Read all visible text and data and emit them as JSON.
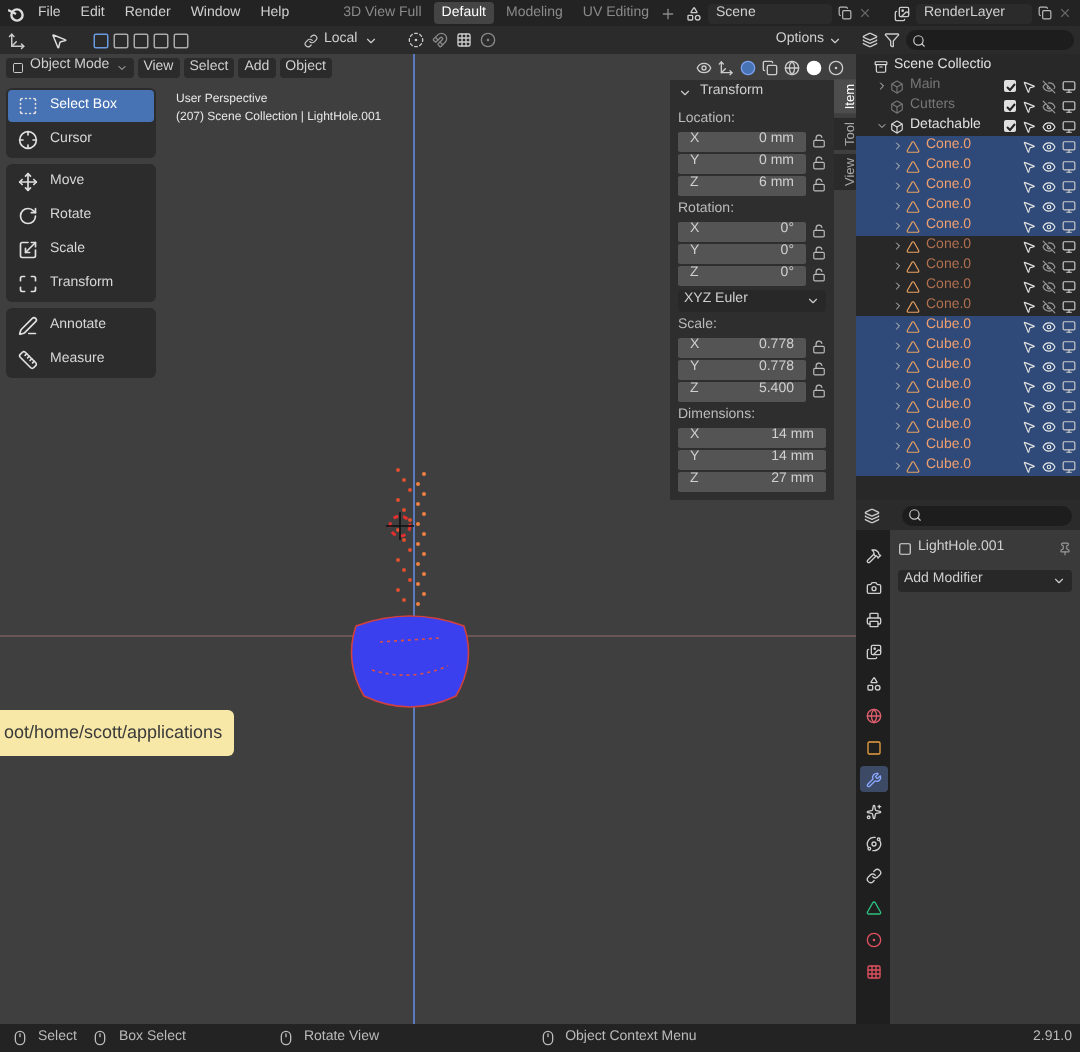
{
  "menu": [
    "File",
    "Edit",
    "Render",
    "Window",
    "Help"
  ],
  "workspace_tabs": [
    {
      "label": "3D View Full",
      "selected": false
    },
    {
      "label": "Default",
      "selected": true
    },
    {
      "label": "Modeling",
      "selected": false
    },
    {
      "label": "UV Editing",
      "selected": false
    }
  ],
  "scene": "Scene",
  "view_layer": "RenderLayer",
  "tool_settings": {
    "orientation": "Local",
    "options": "Options"
  },
  "viewport_header": {
    "mode": "Object Mode",
    "menus": [
      "View",
      "Select",
      "Add",
      "Object"
    ]
  },
  "toolbar": [
    {
      "tools": [
        {
          "kind": "select_box",
          "label": "Select Box",
          "selected": true
        },
        {
          "kind": "cursor",
          "label": "Cursor",
          "selected": false
        }
      ]
    },
    {
      "tools": [
        {
          "kind": "move",
          "label": "Move",
          "selected": false
        },
        {
          "kind": "rotate",
          "label": "Rotate",
          "selected": false
        },
        {
          "kind": "scale",
          "label": "Scale",
          "selected": false
        },
        {
          "kind": "transform",
          "label": "Transform",
          "selected": false
        }
      ]
    },
    {
      "tools": [
        {
          "kind": "annotate",
          "label": "Annotate",
          "selected": false
        },
        {
          "kind": "measure",
          "label": "Measure",
          "selected": false
        }
      ]
    }
  ],
  "overlay_text": [
    "User Perspective",
    "(207) Scene Collection | LightHole.001"
  ],
  "sidebar": {
    "tabs": [
      {
        "label": "Item",
        "selected": true
      },
      {
        "label": "Tool",
        "selected": false
      },
      {
        "label": "View",
        "selected": false
      }
    ],
    "panel_title": "Transform",
    "sections": [
      {
        "label": "Location:",
        "lockable": true,
        "fields": [
          {
            "axis": "X",
            "value": "0 mm"
          },
          {
            "axis": "Y",
            "value": "0 mm"
          },
          {
            "axis": "Z",
            "value": "6 mm"
          }
        ]
      },
      {
        "label": "Rotation:",
        "lockable": true,
        "fields": [
          {
            "axis": "X",
            "value": "0°"
          },
          {
            "axis": "Y",
            "value": "0°"
          },
          {
            "axis": "Z",
            "value": "0°"
          }
        ],
        "mode": "XYZ Euler"
      },
      {
        "label": "Scale:",
        "lockable": true,
        "fields": [
          {
            "axis": "X",
            "value": "0.778"
          },
          {
            "axis": "Y",
            "value": "0.778"
          },
          {
            "axis": "Z",
            "value": "5.400"
          }
        ]
      },
      {
        "label": "Dimensions:",
        "lockable": false,
        "fields": [
          {
            "axis": "X",
            "value": "14 mm"
          },
          {
            "axis": "Y",
            "value": "14 mm"
          },
          {
            "axis": "Z",
            "value": "27 mm"
          }
        ]
      }
    ]
  },
  "tooltip": "oot/home/scott/applications",
  "outliner": {
    "items": [
      {
        "name": "Scene Collectio",
        "kind": "scene",
        "children": [
          {
            "name": "Main",
            "kind": "collection",
            "excluded": true,
            "checked": true,
            "expanded": false,
            "visible": false
          },
          {
            "name": "Cutters",
            "kind": "collection",
            "excluded": true,
            "checked": true,
            "visible": false
          },
          {
            "name": "Detachable",
            "kind": "collection",
            "excluded": false,
            "checked": true,
            "expanded": true,
            "visible": true,
            "children": [
              {
                "name": "Cone.0",
                "kind": "mesh",
                "selected": true,
                "visible": true,
                "expanded": false
              },
              {
                "name": "Cone.0",
                "kind": "mesh",
                "selected": true,
                "visible": true,
                "expanded": false
              },
              {
                "name": "Cone.0",
                "kind": "mesh",
                "selected": true,
                "visible": true,
                "expanded": false
              },
              {
                "name": "Cone.0",
                "kind": "mesh",
                "selected": true,
                "visible": true,
                "expanded": false
              },
              {
                "name": "Cone.0",
                "kind": "mesh",
                "selected": true,
                "visible": true,
                "expanded": false
              },
              {
                "name": "Cone.0",
                "kind": "mesh",
                "selected": false,
                "visible": false,
                "expanded": false
              },
              {
                "name": "Cone.0",
                "kind": "mesh",
                "selected": false,
                "visible": false,
                "expanded": false
              },
              {
                "name": "Cone.0",
                "kind": "mesh",
                "selected": false,
                "visible": false,
                "expanded": false
              },
              {
                "name": "Cone.0",
                "kind": "mesh",
                "selected": false,
                "visible": false,
                "expanded": false
              },
              {
                "name": "Cube.0",
                "kind": "mesh",
                "selected": true,
                "visible": true,
                "expanded": false
              },
              {
                "name": "Cube.0",
                "kind": "mesh",
                "selected": true,
                "visible": true,
                "expanded": false
              },
              {
                "name": "Cube.0",
                "kind": "mesh",
                "selected": true,
                "visible": true,
                "expanded": false
              },
              {
                "name": "Cube.0",
                "kind": "mesh",
                "selected": true,
                "visible": true,
                "expanded": false
              },
              {
                "name": "Cube.0",
                "kind": "mesh",
                "selected": true,
                "visible": true,
                "expanded": false
              },
              {
                "name": "Cube.0",
                "kind": "mesh",
                "selected": true,
                "visible": true,
                "expanded": false
              },
              {
                "name": "Cube.0",
                "kind": "mesh",
                "selected": true,
                "visible": true,
                "expanded": false
              },
              {
                "name": "Cube.0",
                "kind": "mesh",
                "selected": true,
                "visible": true,
                "expanded": false
              }
            ]
          }
        ]
      }
    ]
  },
  "properties": {
    "object_name": "LightHole.001",
    "add_modifier": "Add Modifier",
    "tabs": [
      {
        "kind": "tool",
        "selected": false
      },
      {
        "kind": "render",
        "selected": false
      },
      {
        "kind": "output",
        "selected": false
      },
      {
        "kind": "view_layer",
        "selected": false
      },
      {
        "kind": "scene",
        "selected": false
      },
      {
        "kind": "world",
        "selected": false
      },
      {
        "kind": "object",
        "selected": false
      },
      {
        "kind": "modifier",
        "selected": true
      },
      {
        "kind": "particles",
        "selected": false
      },
      {
        "kind": "physics",
        "selected": false
      },
      {
        "kind": "constraints",
        "selected": false
      },
      {
        "kind": "data",
        "selected": false
      },
      {
        "kind": "material",
        "selected": false
      },
      {
        "kind": "texture",
        "selected": false
      }
    ]
  },
  "status_bar": {
    "hints": [
      "Select",
      "Box Select",
      "Rotate View",
      "Object Context Menu"
    ],
    "version": "2.91.0"
  }
}
